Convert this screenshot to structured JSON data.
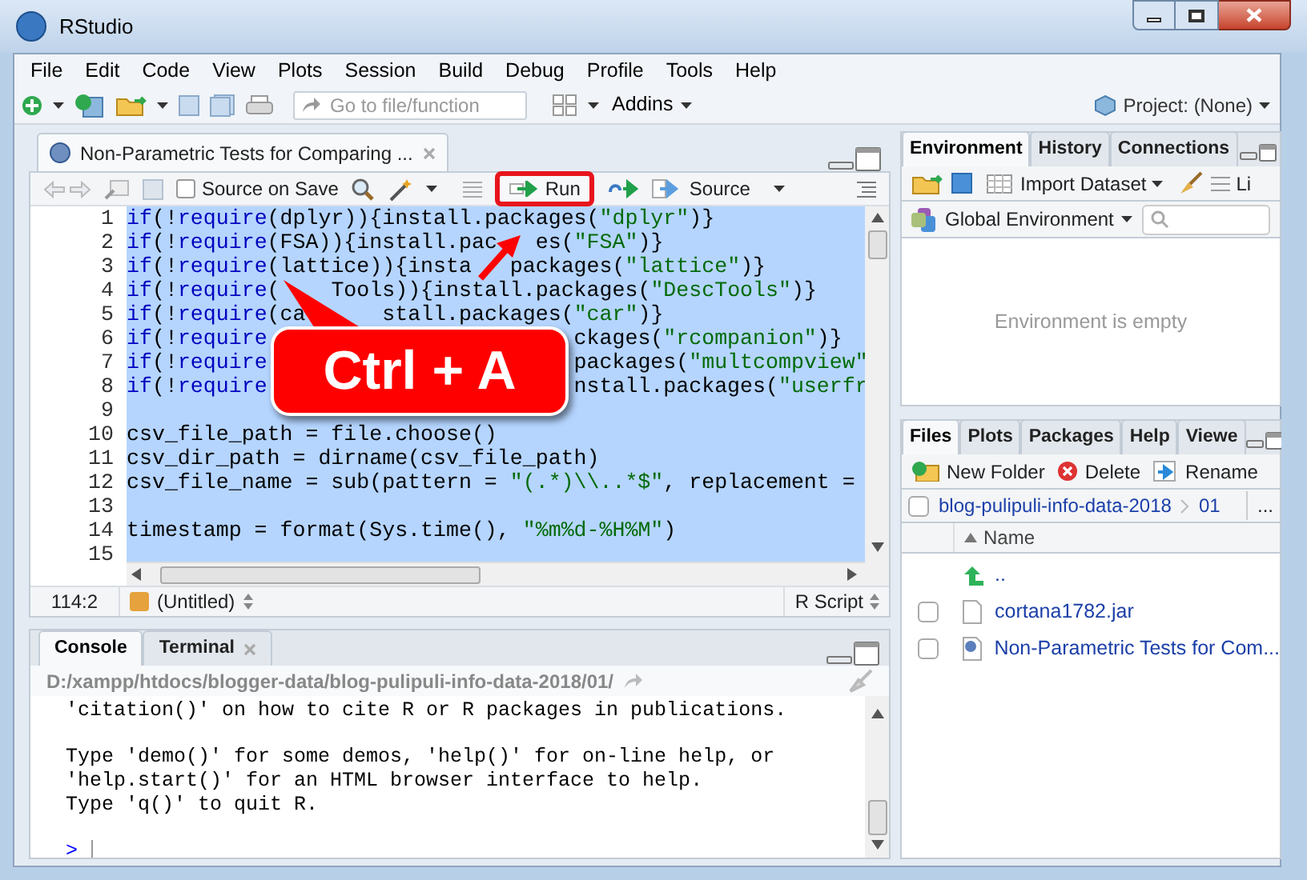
{
  "window": {
    "title": "RStudio"
  },
  "menu": [
    "File",
    "Edit",
    "Code",
    "View",
    "Plots",
    "Session",
    "Build",
    "Debug",
    "Profile",
    "Tools",
    "Help"
  ],
  "toolbar": {
    "goto_placeholder": "Go to file/function",
    "addins": "Addins",
    "project": "Project: (None)"
  },
  "editor": {
    "tabs": [
      {
        "label": "Non-Parametric Tests for Comparing ...",
        "selected": true
      }
    ],
    "source_on_save": {
      "label": "Source on Save",
      "checked": false
    },
    "run": "Run",
    "source": "Source",
    "lines": [
      {
        "number": "1",
        "segments": [
          "if(!require(dplyr)){install.packages(\"dplyr\")}"
        ]
      },
      {
        "number": "2",
        "segments": [
          "if(!require(FSA)){install.pac",
          "es(\"FSA\")}"
        ]
      },
      {
        "number": "3",
        "segments": [
          "if(!require(lattice)){insta",
          "packages(\"lattice\")}"
        ]
      },
      {
        "number": "4",
        "segments": [
          "if(!require(",
          "Tools)){install.packages(\"DescTools\")}"
        ]
      },
      {
        "number": "5",
        "segments": [
          "if(!require(ca",
          "stall.packages(\"car\")}"
        ]
      },
      {
        "number": "6",
        "segments": [
          "if(!require",
          "ckages(\"rcompanion\")}"
        ]
      },
      {
        "number": "7",
        "segments": [
          "if(!require",
          "packages(\"multcompview\""
        ]
      },
      {
        "number": "8",
        "segments": [
          "if(!require",
          "nstall.packages(\"userfr"
        ]
      },
      {
        "number": "9"
      },
      {
        "number": "10",
        "segments": [
          "csv_file_path = file.choose()"
        ]
      },
      {
        "number": "11",
        "segments": [
          "csv_dir_path = dirname(csv_file_path)"
        ]
      },
      {
        "number": "12",
        "segments": [
          "csv_file_name = sub(pattern = \"(.*)\\\\..*$\", replacement ="
        ]
      },
      {
        "number": "13"
      },
      {
        "number": "14",
        "segments": [
          "timestamp = format(Sys.time(), \"%m%d-%H%M\")"
        ]
      },
      {
        "number": "15"
      }
    ],
    "cursor": "114:2",
    "context": "(Untitled)",
    "filetype": "R Script"
  },
  "callout": {
    "text": "Ctrl + A"
  },
  "console": {
    "tabs": [
      {
        "label": "Console",
        "selected": true,
        "closable": false
      },
      {
        "label": "Terminal",
        "selected": false,
        "closable": true
      }
    ],
    "path": "D:/xampp/htdocs/blogger-data/blog-pulipuli-info-data-2018/01/",
    "output": [
      [
        "'citation()' on how to cite R or R packages in publications."
      ],
      [
        "Type 'demo()' for some demos, 'help()' for on-line help, or",
        "'help.start()' for an HTML browser interface to help.",
        "Type 'q()' to quit R."
      ]
    ],
    "prompt": ">"
  },
  "environment": {
    "tabs": [
      {
        "label": "Environment",
        "selected": true
      },
      {
        "label": "History",
        "selected": false
      },
      {
        "label": "Connections",
        "selected": false
      }
    ],
    "import": "Import Dataset",
    "list": "Li",
    "scope": "Global Environment",
    "empty": "Environment is empty"
  },
  "files": {
    "tabs": [
      {
        "label": "Files",
        "selected": true
      },
      {
        "label": "Plots",
        "selected": false
      },
      {
        "label": "Packages",
        "selected": false
      },
      {
        "label": "Help",
        "selected": false
      },
      {
        "label": "Viewe",
        "selected": false
      }
    ],
    "actions": [
      "New Folder",
      "Delete",
      "Rename"
    ],
    "select_all": {
      "checked": false
    },
    "breadcrumb": [
      "blog-pulipuli-info-data-2018",
      "01"
    ],
    "more": "...",
    "column": "Name",
    "rows": [
      {
        "kind": "parent",
        "name": ".."
      },
      {
        "kind": "file",
        "name": "cortana1782.jar",
        "checked": false
      },
      {
        "kind": "rscript",
        "name": "Non-Parametric Tests for Com...",
        "checked": false
      }
    ]
  }
}
